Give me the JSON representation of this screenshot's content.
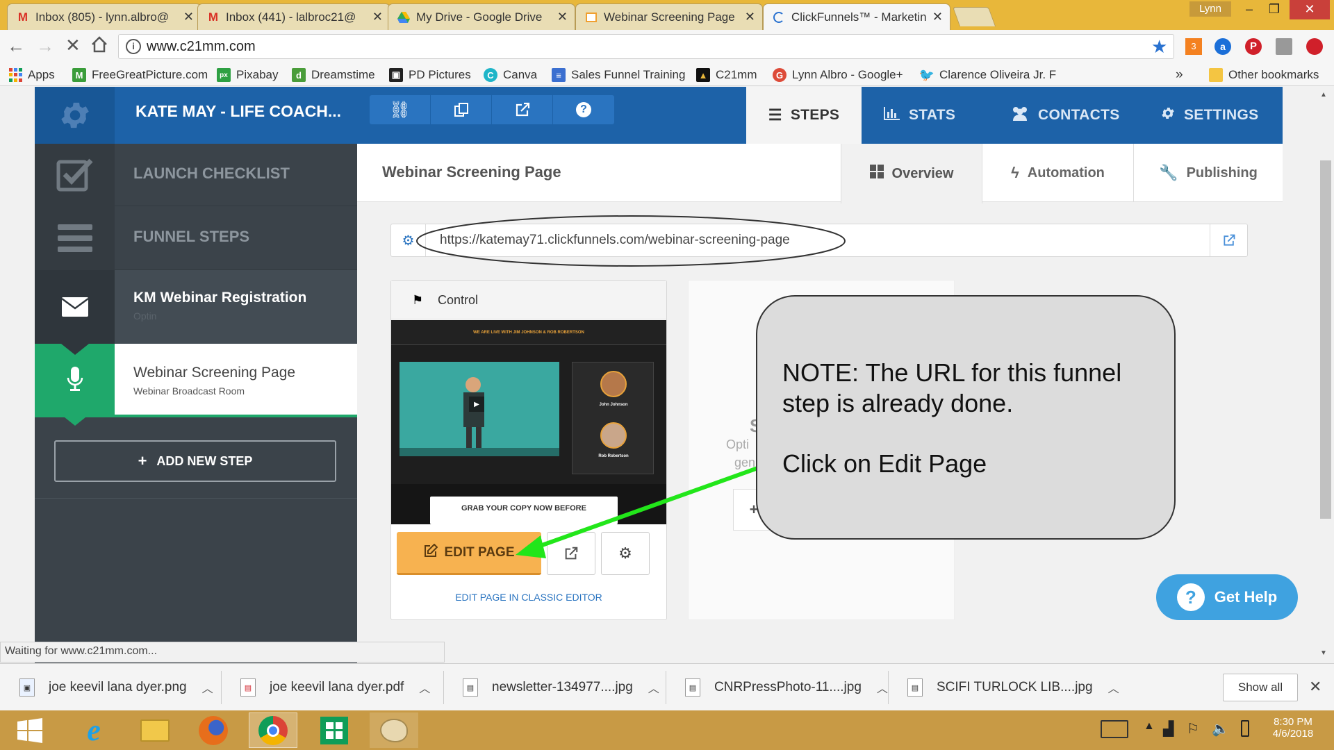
{
  "browser": {
    "tabs": [
      {
        "title": "Inbox (805) - lynn.albro@",
        "icon": "gmail-icon"
      },
      {
        "title": "Inbox (441) - lalbroc21@",
        "icon": "gmail-icon"
      },
      {
        "title": "My Drive - Google Drive",
        "icon": "google-drive-icon"
      },
      {
        "title": "Webinar Screening Page",
        "icon": "page-icon"
      },
      {
        "title": "ClickFunnels™ - Marketin",
        "icon": "loading-icon",
        "active": true
      }
    ],
    "user": "Lynn",
    "url": "www.c21mm.com",
    "bookmarks": [
      {
        "label": "Apps",
        "icon": "apps-grid-icon"
      },
      {
        "label": "FreeGreatPicture.com",
        "icon": "m-logo-icon"
      },
      {
        "label": "Pixabay",
        "icon": "pixabay-icon"
      },
      {
        "label": "Dreamstime",
        "icon": "dreamstime-icon"
      },
      {
        "label": "PD Pictures",
        "icon": "pd-pictures-icon"
      },
      {
        "label": "Canva",
        "icon": "canva-icon"
      },
      {
        "label": "Sales Funnel Training",
        "icon": "document-icon"
      },
      {
        "label": "C21mm",
        "icon": "c21mm-icon"
      },
      {
        "label": "Lynn Albro - Google+",
        "icon": "google-plus-icon"
      },
      {
        "label": "Clarence Oliveira Jr. F",
        "icon": "twitter-icon"
      }
    ],
    "more_bookmarks": "»",
    "other_bookmarks": "Other bookmarks",
    "status_text": "Waiting for www.c21mm.com..."
  },
  "app": {
    "funnel_name": "KATE MAY - LIFE COACH...",
    "nav": {
      "steps": "STEPS",
      "stats": "STATS",
      "contacts": "CONTACTS",
      "settings": "SETTINGS"
    },
    "sidebar": {
      "launch_checklist": "LAUNCH CHECKLIST",
      "funnel_steps": "FUNNEL STEPS",
      "steps": [
        {
          "title": "KM Webinar Registration",
          "subtitle": "Optin"
        },
        {
          "title": "Webinar Screening Page",
          "subtitle": "Webinar Broadcast Room"
        }
      ],
      "add_step": "ADD NEW STEP"
    },
    "main": {
      "page_title": "Webinar Screening Page",
      "tabs": {
        "overview": "Overview",
        "automation": "Automation",
        "publishing": "Publishing"
      },
      "page_url": "https://katemay71.clickfunnels.com/webinar-screening-page",
      "variant_label": "Control",
      "thumb": {
        "banner": "WE ARE LIVE WITH JIM JOHNSON & ROB ROBERTSON",
        "host1": "John Johnson",
        "host2": "Rob Robertson",
        "cta": "GRAB YOUR COPY NOW BEFORE"
      },
      "edit_page": "EDIT PAGE",
      "classic_editor": "EDIT PAGE IN CLASSIC EDITOR",
      "split_partial": {
        "line1": "S",
        "line2": "Opti",
        "line3": "gen",
        "plus": "+"
      }
    },
    "get_help": "Get Help"
  },
  "annotation": {
    "note": "NOTE: The URL for this funnel step is already done.",
    "instruction": "Click on Edit Page",
    "arrow_color": "#22e61a",
    "ellipse_color": "#333333"
  },
  "downloads": {
    "items": [
      {
        "name": "joe keevil lana dyer.png"
      },
      {
        "name": "joe keevil lana dyer.pdf"
      },
      {
        "name": "newsletter-134977....jpg"
      },
      {
        "name": "CNRPressPhoto-11....jpg"
      },
      {
        "name": "SCIFI TURLOCK LIB....jpg"
      }
    ],
    "show_all": "Show all"
  },
  "taskbar": {
    "time": "8:30 PM",
    "date": "4/6/2018"
  },
  "colors": {
    "nav_blue": "#1d62a8",
    "sidebar": "#3b434a",
    "active_green": "#1fa86b",
    "edit_orange": "#f7b250",
    "help_blue": "#3fa2e0"
  }
}
